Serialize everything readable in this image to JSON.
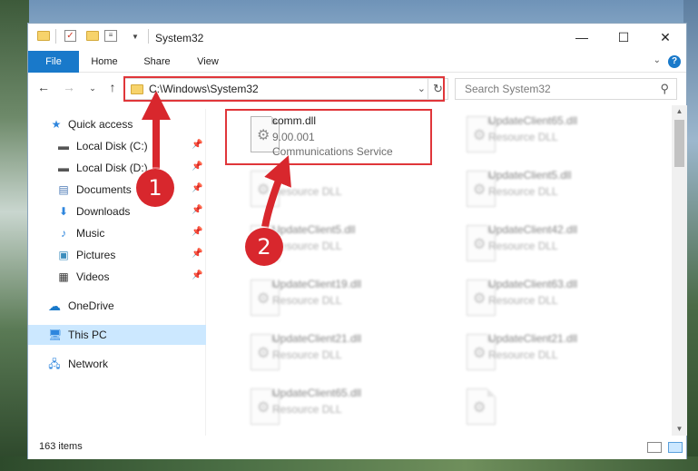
{
  "window": {
    "title": "System32",
    "controls": {
      "minimize": "—",
      "maximize": "☐",
      "close": "✕"
    }
  },
  "ribbon": {
    "tabs": [
      "File",
      "Home",
      "Share",
      "View"
    ],
    "help": "?"
  },
  "address_bar": {
    "path": "C:\\Windows\\System32"
  },
  "search": {
    "placeholder": "Search System32"
  },
  "sidebar": {
    "items": [
      {
        "label": "Quick access",
        "icon": "star-icon",
        "pinned": false
      },
      {
        "label": "Local Disk (C:)",
        "icon": "drive-icon",
        "pinned": true
      },
      {
        "label": "Local Disk (D:)",
        "icon": "drive-icon",
        "pinned": true
      },
      {
        "label": "Documents",
        "icon": "document-icon",
        "pinned": true
      },
      {
        "label": "Downloads",
        "icon": "download-icon",
        "pinned": true
      },
      {
        "label": "Music",
        "icon": "music-icon",
        "pinned": true
      },
      {
        "label": "Pictures",
        "icon": "pictures-icon",
        "pinned": true
      },
      {
        "label": "Videos",
        "icon": "video-icon",
        "pinned": true
      },
      {
        "label": "OneDrive",
        "icon": "cloud-icon",
        "pinned": false
      },
      {
        "label": "This PC",
        "icon": "computer-icon",
        "pinned": false,
        "selected": true
      },
      {
        "label": "Network",
        "icon": "network-icon",
        "pinned": false
      }
    ]
  },
  "files": {
    "highlighted": {
      "name": "comm.dll",
      "version": "9.00.001",
      "description": "Communications Service"
    },
    "blurred_left": [
      {
        "name": "",
        "type": "Resource DLL"
      },
      {
        "name": "UpdateClient5.dll",
        "type": "Resource DLL"
      },
      {
        "name": "UpdateClient19.dll",
        "type": "Resource DLL"
      },
      {
        "name": "UpdateClient21.dll",
        "type": "Resource DLL"
      },
      {
        "name": "UpdateClient65.dll",
        "type": "Resource DLL"
      },
      {
        "name": "",
        "type": ""
      }
    ],
    "blurred_right": [
      {
        "name": "UpdateClient65.dll",
        "type": "Resource DLL"
      },
      {
        "name": "UpdateClient5.dll",
        "type": "Resource DLL"
      },
      {
        "name": "UpdateClient42.dll",
        "type": "Resource DLL"
      },
      {
        "name": "UpdateClient63.dll",
        "type": "Resource DLL"
      },
      {
        "name": "UpdateClient21.dll",
        "type": "Resource DLL"
      },
      {
        "name": "",
        "type": ""
      }
    ]
  },
  "status": {
    "item_count": "163 items"
  },
  "annotations": {
    "callout_1": "1",
    "callout_2": "2",
    "color": "#d8272d"
  }
}
